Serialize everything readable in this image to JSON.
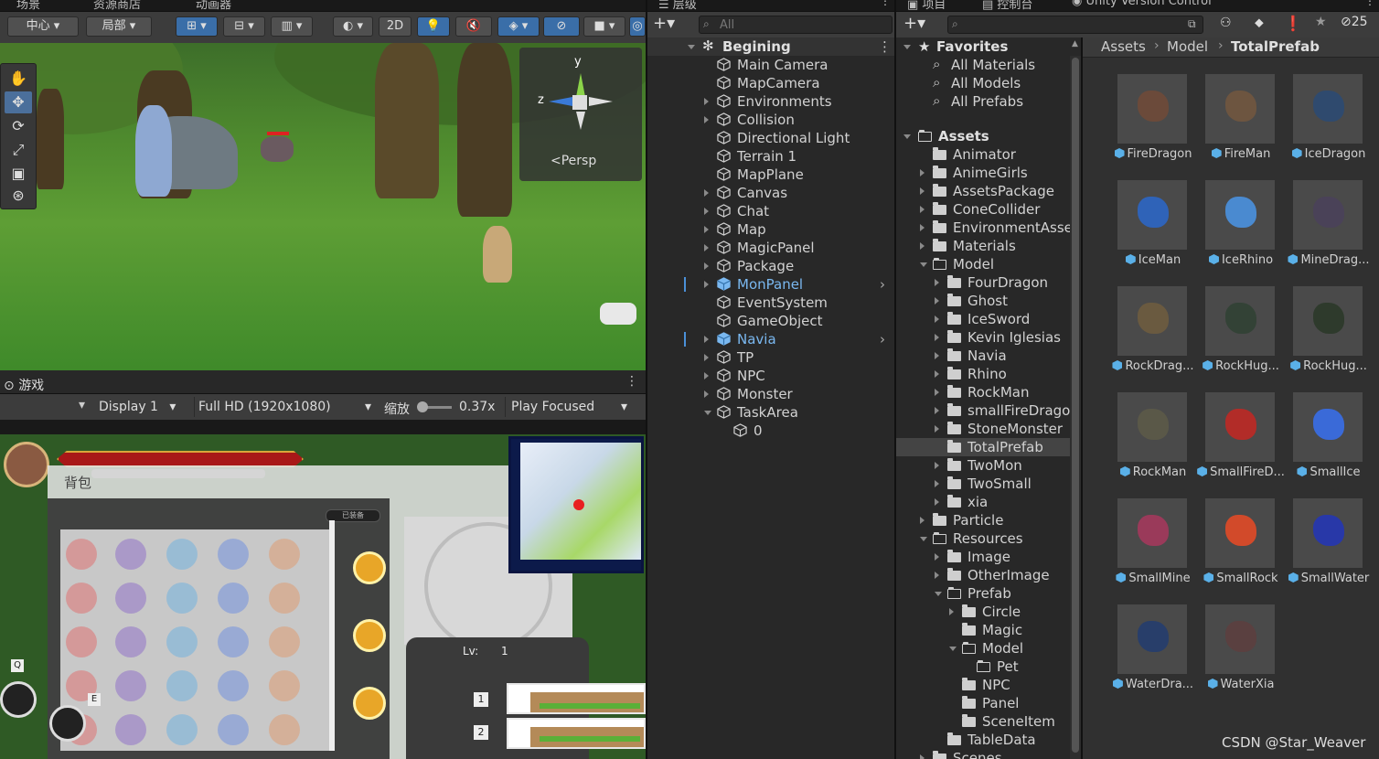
{
  "scene_panel": {
    "tabs": [
      "场景",
      "资源商店",
      "动画器"
    ],
    "pivot_label": "中心",
    "space_label": "局部",
    "btn_2d": "2D",
    "gizmo": {
      "axis_y": "y",
      "axis_z": "z",
      "persp_label": "<Persp"
    }
  },
  "game_panel": {
    "tab": "游戏",
    "display": "Display 1",
    "resolution": "Full HD (1920x1080)",
    "scale_label": "缩放",
    "scale_value": "0.37x",
    "play_mode": "Play Focused",
    "hud": {
      "bag_title": "背包",
      "bag_badge": "已装备",
      "lv_label": "Lv:",
      "lv_value": "1",
      "key_q": "Q",
      "key_e": "E",
      "slot1": "1",
      "slot2": "2",
      "zero": "0"
    }
  },
  "hierarchy": {
    "tab": "层级",
    "search_placeholder": "All",
    "scene_name": "Begining",
    "items": [
      {
        "label": "Main Camera",
        "arrow": false,
        "prefab": false
      },
      {
        "label": "MapCamera",
        "arrow": false,
        "prefab": false
      },
      {
        "label": "Environments",
        "arrow": true,
        "prefab": false
      },
      {
        "label": "Collision",
        "arrow": true,
        "prefab": false
      },
      {
        "label": "Directional Light",
        "arrow": false,
        "prefab": false
      },
      {
        "label": "Terrain 1",
        "arrow": false,
        "prefab": false
      },
      {
        "label": "MapPlane",
        "arrow": false,
        "prefab": false
      },
      {
        "label": "Canvas",
        "arrow": true,
        "prefab": false
      },
      {
        "label": "Chat",
        "arrow": true,
        "prefab": false
      },
      {
        "label": "Map",
        "arrow": true,
        "prefab": false
      },
      {
        "label": "MagicPanel",
        "arrow": true,
        "prefab": false
      },
      {
        "label": "Package",
        "arrow": true,
        "prefab": false
      },
      {
        "label": "MonPanel",
        "arrow": true,
        "prefab": true
      },
      {
        "label": "EventSystem",
        "arrow": false,
        "prefab": false
      },
      {
        "label": "GameObject",
        "arrow": false,
        "prefab": false
      },
      {
        "label": "Navia",
        "arrow": true,
        "prefab": true
      },
      {
        "label": "TP",
        "arrow": true,
        "prefab": false
      },
      {
        "label": "NPC",
        "arrow": true,
        "prefab": false
      },
      {
        "label": "Monster",
        "arrow": true,
        "prefab": false
      },
      {
        "label": "TaskArea",
        "arrow": true,
        "prefab": false,
        "open": true
      }
    ],
    "child": "0"
  },
  "project": {
    "tabs": [
      "项目",
      "控制台",
      "Unity Version Control"
    ],
    "badge_count": "25",
    "favorites": {
      "title": "Favorites",
      "items": [
        "All Materials",
        "All Models",
        "All Prefabs"
      ]
    },
    "assets_root": "Assets",
    "tree": [
      {
        "label": "Animator",
        "depth": 1,
        "arrow": false,
        "open": false
      },
      {
        "label": "AnimeGirls",
        "depth": 1,
        "arrow": true,
        "open": false
      },
      {
        "label": "AssetsPackage",
        "depth": 1,
        "arrow": true,
        "open": false
      },
      {
        "label": "ConeCollider",
        "depth": 1,
        "arrow": true,
        "open": false
      },
      {
        "label": "EnvironmentAssets",
        "depth": 1,
        "arrow": true,
        "open": false
      },
      {
        "label": "Materials",
        "depth": 1,
        "arrow": true,
        "open": false
      },
      {
        "label": "Model",
        "depth": 1,
        "arrow": true,
        "open": true
      },
      {
        "label": "FourDragon",
        "depth": 2,
        "arrow": true,
        "open": false
      },
      {
        "label": "Ghost",
        "depth": 2,
        "arrow": true,
        "open": false
      },
      {
        "label": "IceSword",
        "depth": 2,
        "arrow": true,
        "open": false
      },
      {
        "label": "Kevin Iglesias",
        "depth": 2,
        "arrow": true,
        "open": false
      },
      {
        "label": "Navia",
        "depth": 2,
        "arrow": true,
        "open": false
      },
      {
        "label": "Rhino",
        "depth": 2,
        "arrow": true,
        "open": false
      },
      {
        "label": "RockMan",
        "depth": 2,
        "arrow": true,
        "open": false
      },
      {
        "label": "smallFireDragon",
        "depth": 2,
        "arrow": true,
        "open": false
      },
      {
        "label": "StoneMonster",
        "depth": 2,
        "arrow": true,
        "open": false
      },
      {
        "label": "TotalPrefab",
        "depth": 2,
        "arrow": false,
        "open": false,
        "selected": true
      },
      {
        "label": "TwoMon",
        "depth": 2,
        "arrow": true,
        "open": false
      },
      {
        "label": "TwoSmall",
        "depth": 2,
        "arrow": true,
        "open": false
      },
      {
        "label": "xia",
        "depth": 2,
        "arrow": true,
        "open": false
      },
      {
        "label": "Particle",
        "depth": 1,
        "arrow": true,
        "open": false
      },
      {
        "label": "Resources",
        "depth": 1,
        "arrow": true,
        "open": true
      },
      {
        "label": "Image",
        "depth": 2,
        "arrow": true,
        "open": false
      },
      {
        "label": "OtherImage",
        "depth": 2,
        "arrow": true,
        "open": false
      },
      {
        "label": "Prefab",
        "depth": 2,
        "arrow": true,
        "open": true
      },
      {
        "label": "Circle",
        "depth": 3,
        "arrow": true,
        "open": false
      },
      {
        "label": "Magic",
        "depth": 3,
        "arrow": false,
        "open": false
      },
      {
        "label": "Model",
        "depth": 3,
        "arrow": true,
        "open": true
      },
      {
        "label": "Pet",
        "depth": 4,
        "arrow": false,
        "open": false,
        "empty": true
      },
      {
        "label": "NPC",
        "depth": 3,
        "arrow": false,
        "open": false
      },
      {
        "label": "Panel",
        "depth": 3,
        "arrow": false,
        "open": false
      },
      {
        "label": "SceneItem",
        "depth": 3,
        "arrow": false,
        "open": false
      },
      {
        "label": "TableData",
        "depth": 2,
        "arrow": false,
        "open": false
      },
      {
        "label": "Scenes",
        "depth": 1,
        "arrow": true,
        "open": false
      }
    ],
    "breadcrumb": [
      "Assets",
      "Model",
      "TotalPrefab"
    ],
    "assets": [
      {
        "label": "FireDragon",
        "color": "#6b4a3a"
      },
      {
        "label": "FireMan",
        "color": "#6d5540"
      },
      {
        "label": "IceDragon",
        "color": "#2f4a6e"
      },
      {
        "label": "IceMan",
        "color": "#2f63b8"
      },
      {
        "label": "IceRhino",
        "color": "#4a8ad0"
      },
      {
        "label": "MineDrag...",
        "color": "#4a4258"
      },
      {
        "label": "RockDrag...",
        "color": "#6a5a40"
      },
      {
        "label": "RockHug...",
        "color": "#334236"
      },
      {
        "label": "RockHug...",
        "color": "#2e3a2c"
      },
      {
        "label": "RockMan",
        "color": "#5a5848"
      },
      {
        "label": "SmallFireD...",
        "color": "#b22c28"
      },
      {
        "label": "SmallIce",
        "color": "#3a6ad8"
      },
      {
        "label": "SmallMine",
        "color": "#9a3a5a"
      },
      {
        "label": "SmallRock",
        "color": "#d24a2a"
      },
      {
        "label": "SmallWater",
        "color": "#2838a8"
      },
      {
        "label": "WaterDra...",
        "color": "#283e6a"
      },
      {
        "label": "WaterXia",
        "color": "#5a4040"
      }
    ],
    "watermark": "CSDN @Star_Weaver"
  }
}
